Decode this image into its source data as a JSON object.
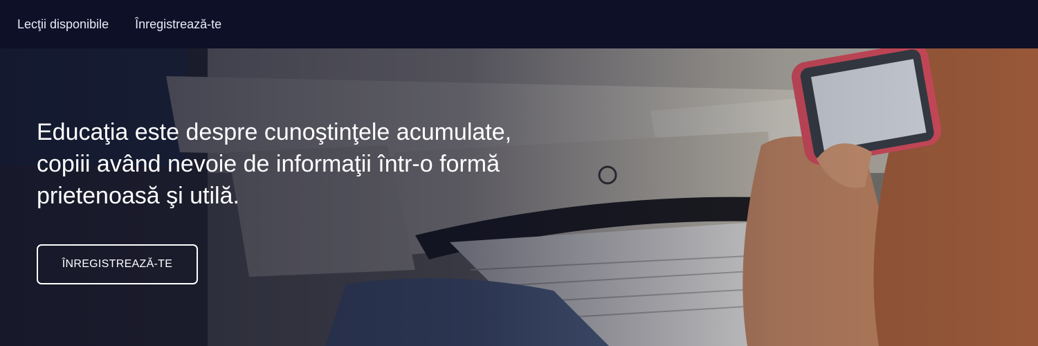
{
  "nav": {
    "lessons_label": "Lecţii disponibile",
    "register_label": "Înregistrează-te"
  },
  "hero": {
    "headline": "Educaţia este despre cunoştinţele acumulate, copiii având nevoie de informaţii într-o formă prietenoasă şi utilă.",
    "cta_label": "ÎNREGISTREAZĂ-TE"
  },
  "colors": {
    "nav_background": "#0e1028",
    "overlay": "#0c0e26",
    "text": "#ffffff",
    "phone_case": "#e0505e"
  }
}
